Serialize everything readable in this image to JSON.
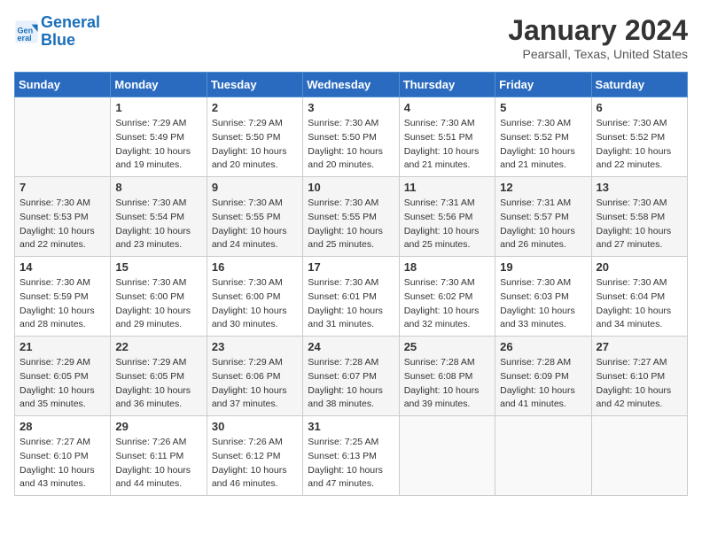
{
  "header": {
    "logo_line1": "General",
    "logo_line2": "Blue",
    "month_title": "January 2024",
    "location": "Pearsall, Texas, United States"
  },
  "days_of_week": [
    "Sunday",
    "Monday",
    "Tuesday",
    "Wednesday",
    "Thursday",
    "Friday",
    "Saturday"
  ],
  "weeks": [
    [
      {
        "num": "",
        "info": ""
      },
      {
        "num": "1",
        "info": "Sunrise: 7:29 AM\nSunset: 5:49 PM\nDaylight: 10 hours\nand 19 minutes."
      },
      {
        "num": "2",
        "info": "Sunrise: 7:29 AM\nSunset: 5:50 PM\nDaylight: 10 hours\nand 20 minutes."
      },
      {
        "num": "3",
        "info": "Sunrise: 7:30 AM\nSunset: 5:50 PM\nDaylight: 10 hours\nand 20 minutes."
      },
      {
        "num": "4",
        "info": "Sunrise: 7:30 AM\nSunset: 5:51 PM\nDaylight: 10 hours\nand 21 minutes."
      },
      {
        "num": "5",
        "info": "Sunrise: 7:30 AM\nSunset: 5:52 PM\nDaylight: 10 hours\nand 21 minutes."
      },
      {
        "num": "6",
        "info": "Sunrise: 7:30 AM\nSunset: 5:52 PM\nDaylight: 10 hours\nand 22 minutes."
      }
    ],
    [
      {
        "num": "7",
        "info": "Sunrise: 7:30 AM\nSunset: 5:53 PM\nDaylight: 10 hours\nand 22 minutes."
      },
      {
        "num": "8",
        "info": "Sunrise: 7:30 AM\nSunset: 5:54 PM\nDaylight: 10 hours\nand 23 minutes."
      },
      {
        "num": "9",
        "info": "Sunrise: 7:30 AM\nSunset: 5:55 PM\nDaylight: 10 hours\nand 24 minutes."
      },
      {
        "num": "10",
        "info": "Sunrise: 7:30 AM\nSunset: 5:55 PM\nDaylight: 10 hours\nand 25 minutes."
      },
      {
        "num": "11",
        "info": "Sunrise: 7:31 AM\nSunset: 5:56 PM\nDaylight: 10 hours\nand 25 minutes."
      },
      {
        "num": "12",
        "info": "Sunrise: 7:31 AM\nSunset: 5:57 PM\nDaylight: 10 hours\nand 26 minutes."
      },
      {
        "num": "13",
        "info": "Sunrise: 7:30 AM\nSunset: 5:58 PM\nDaylight: 10 hours\nand 27 minutes."
      }
    ],
    [
      {
        "num": "14",
        "info": "Sunrise: 7:30 AM\nSunset: 5:59 PM\nDaylight: 10 hours\nand 28 minutes."
      },
      {
        "num": "15",
        "info": "Sunrise: 7:30 AM\nSunset: 6:00 PM\nDaylight: 10 hours\nand 29 minutes."
      },
      {
        "num": "16",
        "info": "Sunrise: 7:30 AM\nSunset: 6:00 PM\nDaylight: 10 hours\nand 30 minutes."
      },
      {
        "num": "17",
        "info": "Sunrise: 7:30 AM\nSunset: 6:01 PM\nDaylight: 10 hours\nand 31 minutes."
      },
      {
        "num": "18",
        "info": "Sunrise: 7:30 AM\nSunset: 6:02 PM\nDaylight: 10 hours\nand 32 minutes."
      },
      {
        "num": "19",
        "info": "Sunrise: 7:30 AM\nSunset: 6:03 PM\nDaylight: 10 hours\nand 33 minutes."
      },
      {
        "num": "20",
        "info": "Sunrise: 7:30 AM\nSunset: 6:04 PM\nDaylight: 10 hours\nand 34 minutes."
      }
    ],
    [
      {
        "num": "21",
        "info": "Sunrise: 7:29 AM\nSunset: 6:05 PM\nDaylight: 10 hours\nand 35 minutes."
      },
      {
        "num": "22",
        "info": "Sunrise: 7:29 AM\nSunset: 6:05 PM\nDaylight: 10 hours\nand 36 minutes."
      },
      {
        "num": "23",
        "info": "Sunrise: 7:29 AM\nSunset: 6:06 PM\nDaylight: 10 hours\nand 37 minutes."
      },
      {
        "num": "24",
        "info": "Sunrise: 7:28 AM\nSunset: 6:07 PM\nDaylight: 10 hours\nand 38 minutes."
      },
      {
        "num": "25",
        "info": "Sunrise: 7:28 AM\nSunset: 6:08 PM\nDaylight: 10 hours\nand 39 minutes."
      },
      {
        "num": "26",
        "info": "Sunrise: 7:28 AM\nSunset: 6:09 PM\nDaylight: 10 hours\nand 41 minutes."
      },
      {
        "num": "27",
        "info": "Sunrise: 7:27 AM\nSunset: 6:10 PM\nDaylight: 10 hours\nand 42 minutes."
      }
    ],
    [
      {
        "num": "28",
        "info": "Sunrise: 7:27 AM\nSunset: 6:10 PM\nDaylight: 10 hours\nand 43 minutes."
      },
      {
        "num": "29",
        "info": "Sunrise: 7:26 AM\nSunset: 6:11 PM\nDaylight: 10 hours\nand 44 minutes."
      },
      {
        "num": "30",
        "info": "Sunrise: 7:26 AM\nSunset: 6:12 PM\nDaylight: 10 hours\nand 46 minutes."
      },
      {
        "num": "31",
        "info": "Sunrise: 7:25 AM\nSunset: 6:13 PM\nDaylight: 10 hours\nand 47 minutes."
      },
      {
        "num": "",
        "info": ""
      },
      {
        "num": "",
        "info": ""
      },
      {
        "num": "",
        "info": ""
      }
    ]
  ]
}
